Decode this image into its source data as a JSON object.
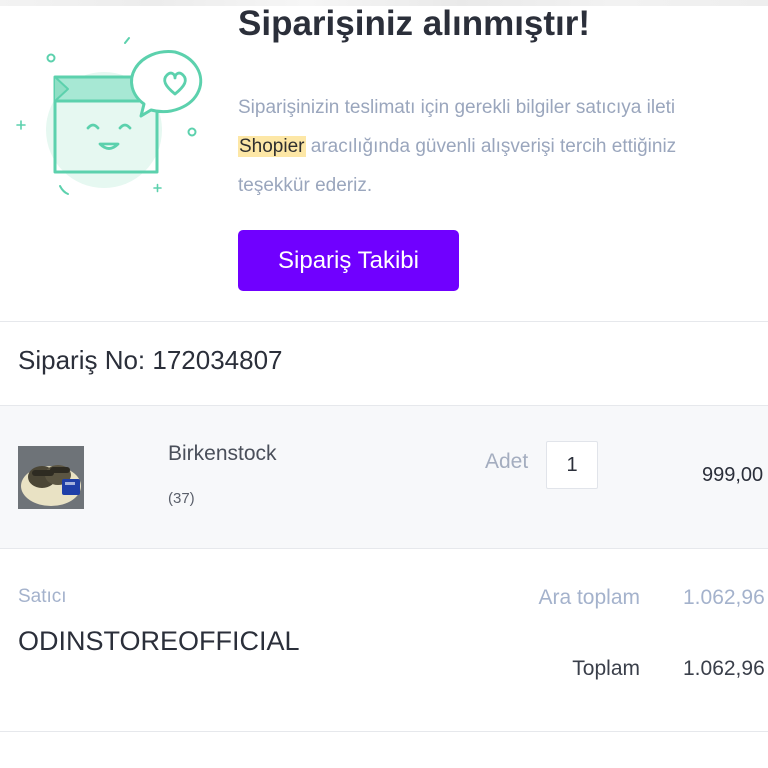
{
  "colors": {
    "accent": "#7000ff",
    "title": "#2b2f3a",
    "muted_text": "#9aa6bd",
    "highlight": "#fde7a6",
    "illustration": "#5cd1ad"
  },
  "success": {
    "illustration_icon": "happy-box-heart-bubble",
    "title": "Siparişiniz alınmıştır!",
    "message_line1": "Siparişinizin teslimatı için gerekli bilgiler satıcıya ileti",
    "brand": "Shopier",
    "message_line2_rest": " aracılığında güvenli alışverişi tercih ettiğiniz",
    "message_line3": "teşekkür ederiz.",
    "track_button_label": "Sipariş Takibi"
  },
  "order": {
    "number_label": "Sipariş No: 172034807"
  },
  "items": [
    {
      "name": "Birkenstock",
      "variant": "(37)",
      "quantity_label": "Adet",
      "quantity": "1",
      "price": "999,00"
    }
  ],
  "summary": {
    "seller_label": "Satıcı",
    "seller_name": "ODINSTOREOFFICIAL",
    "subtotal_label": "Ara toplam",
    "subtotal_value": "1.062,96",
    "total_label": "Toplam",
    "total_value": "1.062,96"
  }
}
